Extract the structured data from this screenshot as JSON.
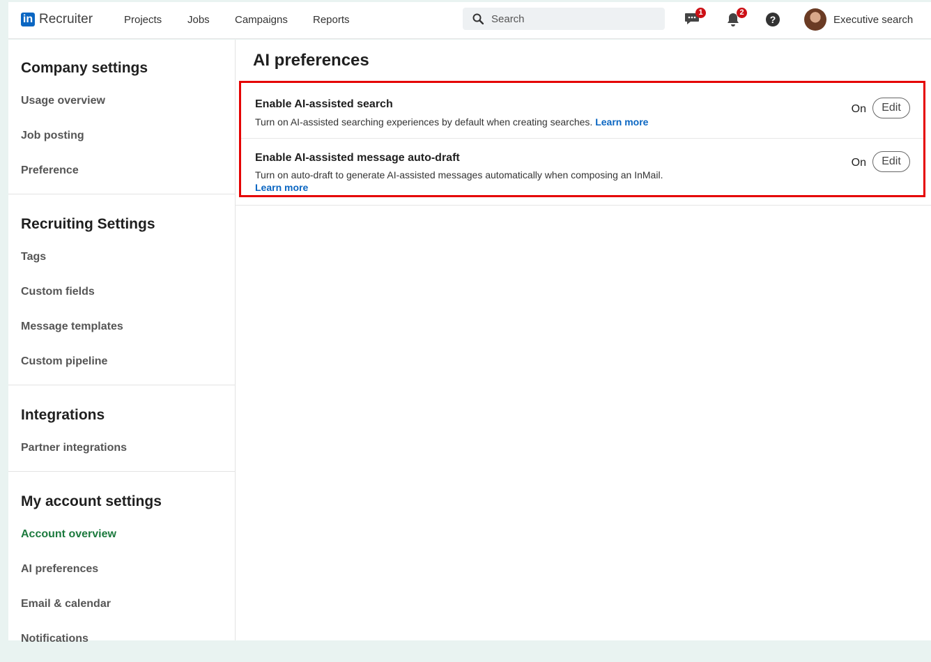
{
  "header": {
    "brand": "Recruiter",
    "logo_text": "in",
    "nav": [
      "Projects",
      "Jobs",
      "Campaigns",
      "Reports"
    ],
    "search_placeholder": "Search",
    "messages_badge": "1",
    "notifications_badge": "2",
    "help_label": "?",
    "account_name": "Executive search"
  },
  "sidebar": {
    "company": {
      "title": "Company settings",
      "items": [
        "Usage overview",
        "Job posting",
        "Preference"
      ]
    },
    "recruiting": {
      "title": "Recruiting Settings",
      "items": [
        "Tags",
        "Custom fields",
        "Message templates",
        "Custom pipeline"
      ]
    },
    "integrations": {
      "title": "Integrations",
      "items": [
        "Partner integrations"
      ]
    },
    "account": {
      "title": "My account settings",
      "items": [
        "Account overview",
        "AI preferences",
        "Email & calendar",
        "Notifications"
      ]
    }
  },
  "main": {
    "title": "AI preferences",
    "prefs": [
      {
        "title": "Enable AI-assisted search",
        "desc": "Turn on AI-assisted searching experiences by default when creating searches.",
        "link": "Learn more",
        "state": "On",
        "edit": "Edit"
      },
      {
        "title": "Enable AI-assisted message auto-draft",
        "desc": "Turn on auto-draft to generate AI-assisted messages automatically when composing an InMail.",
        "link": "Learn more",
        "state": "On",
        "edit": "Edit"
      }
    ]
  },
  "colors": {
    "accent_blue": "#0a66c2",
    "active_green": "#1c7a3e",
    "highlight_red": "#e50000",
    "badge_red": "#cc1016"
  }
}
